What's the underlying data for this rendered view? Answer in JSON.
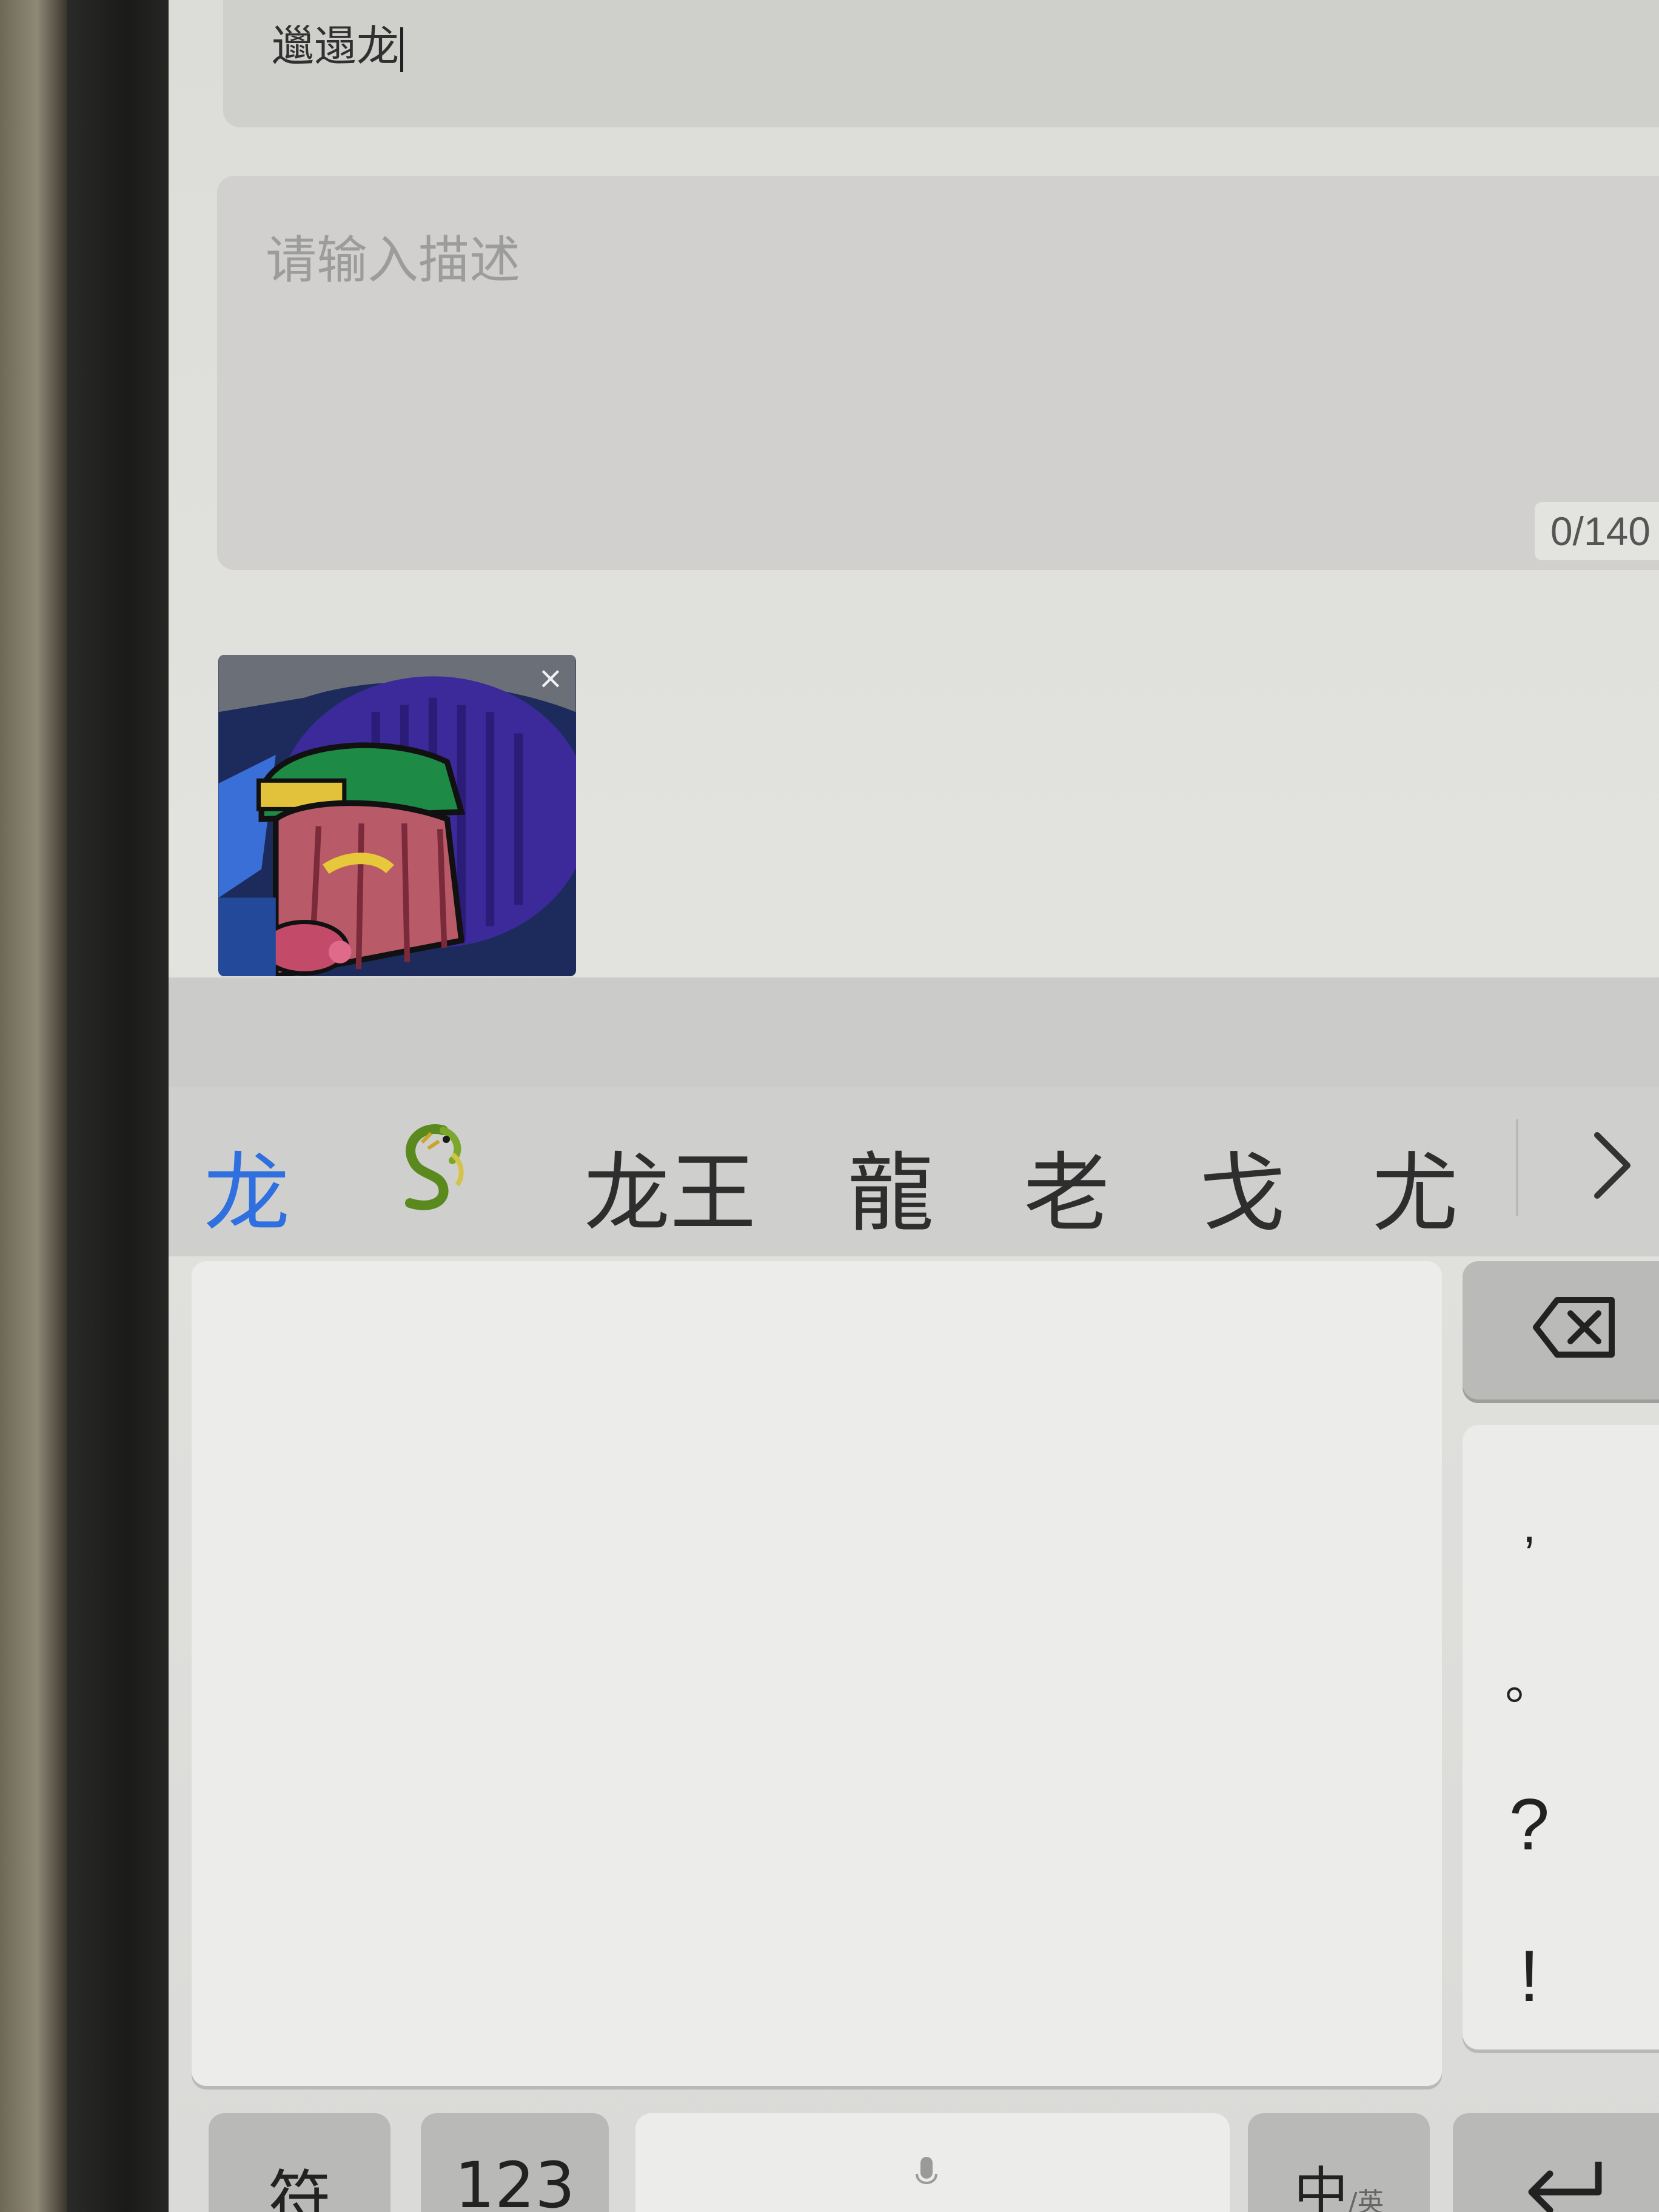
{
  "form": {
    "title_value": "邋遢龙",
    "description_placeholder": "请输入描述",
    "char_counter": "0/140",
    "thumbnail_close": "×"
  },
  "keyboard": {
    "candidates": [
      "龙",
      "龙王",
      "龍",
      "老",
      "戈",
      "尤"
    ],
    "candidate_emoji": "dragon-icon",
    "punctuation": [
      ",",
      "。",
      "?",
      "!"
    ],
    "bottom_row": {
      "symbols_label": "符",
      "numbers_label": "123",
      "lang_label": "中",
      "lang_sub_label": "/英"
    }
  },
  "colors": {
    "candidate_highlight": "#2f6fe0",
    "field_background": "#d1d0ce"
  }
}
